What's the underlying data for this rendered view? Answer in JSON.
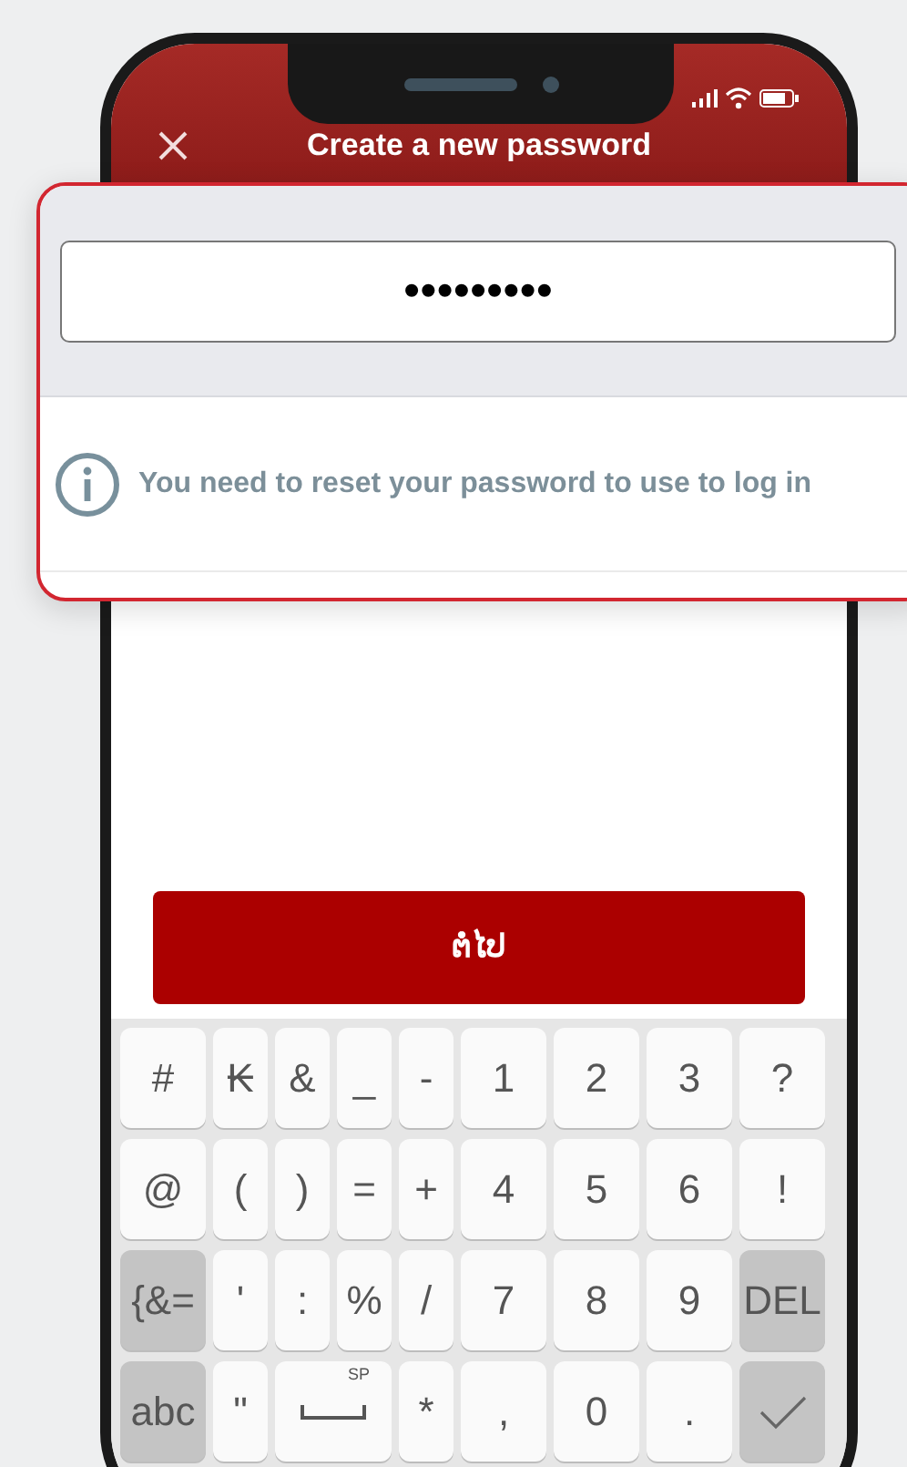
{
  "header": {
    "title": "Create a new password"
  },
  "password_field": {
    "value": "•••••••••"
  },
  "notice": {
    "text": "You need to reset your password to use to log in"
  },
  "next_button": {
    "label": "ຕໍ່ໄປ"
  },
  "keyboard": {
    "rows": [
      [
        {
          "kind": "char",
          "label": "#"
        },
        {
          "kind": "char",
          "label": "₭"
        },
        {
          "kind": "char",
          "label": "&"
        },
        {
          "kind": "char",
          "label": "_"
        },
        {
          "kind": "char",
          "label": "-"
        },
        {
          "kind": "char",
          "label": "1"
        },
        {
          "kind": "char",
          "label": "2"
        },
        {
          "kind": "char",
          "label": "3"
        },
        {
          "kind": "char",
          "label": "?"
        }
      ],
      [
        {
          "kind": "char",
          "label": "@"
        },
        {
          "kind": "char",
          "label": "("
        },
        {
          "kind": "char",
          "label": ")"
        },
        {
          "kind": "char",
          "label": "="
        },
        {
          "kind": "char",
          "label": "+"
        },
        {
          "kind": "char",
          "label": "4"
        },
        {
          "kind": "char",
          "label": "5"
        },
        {
          "kind": "char",
          "label": "6"
        },
        {
          "kind": "char",
          "label": "!"
        }
      ],
      [
        {
          "kind": "function",
          "label": "{&="
        },
        {
          "kind": "char",
          "label": "'"
        },
        {
          "kind": "char",
          "label": ":"
        },
        {
          "kind": "char",
          "label": "%"
        },
        {
          "kind": "char",
          "label": "/"
        },
        {
          "kind": "char",
          "label": "7"
        },
        {
          "kind": "char",
          "label": "8"
        },
        {
          "kind": "char",
          "label": "9"
        },
        {
          "kind": "function",
          "label": "DEL"
        }
      ]
    ],
    "bottom_row": [
      {
        "kind": "function",
        "label": "abc"
      },
      {
        "kind": "char",
        "label": "\""
      },
      {
        "kind": "space",
        "label": "SP"
      },
      {
        "kind": "char",
        "label": "*"
      },
      {
        "kind": "char",
        "label": ","
      },
      {
        "kind": "char",
        "label": "0"
      },
      {
        "kind": "char",
        "label": "."
      },
      {
        "kind": "done"
      }
    ]
  }
}
